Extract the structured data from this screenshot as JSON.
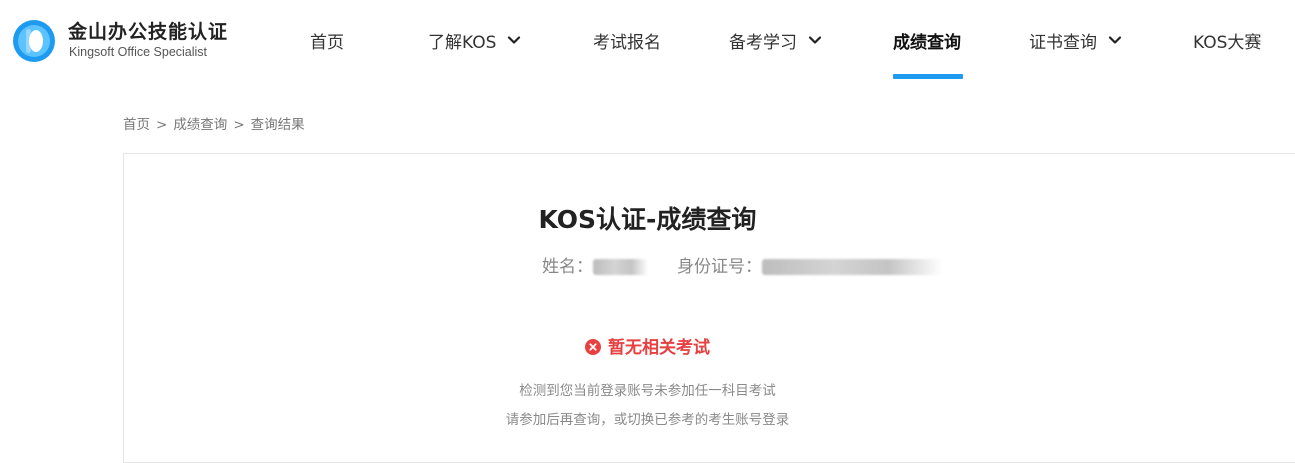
{
  "brand": {
    "title": "金山办公技能认证",
    "subtitle": "Kingsoft Office Specialist"
  },
  "nav": {
    "home": "首页",
    "about": "了解KOS",
    "register": "考试报名",
    "study": "备考学习",
    "scores": "成绩查询",
    "certificate": "证书查询",
    "contest": "KOS大赛"
  },
  "breadcrumb": {
    "home": "首页",
    "scores": "成绩查询",
    "current": "查询结果",
    "separator": ">"
  },
  "result": {
    "title": "KOS认证-成绩查询",
    "name_label": "姓名：",
    "id_label": "身份证号：",
    "status": "暂无相关考试",
    "message_line1": "检测到您当前登录账号未参加任一科目考试",
    "message_line2": "请参加后再查询，或切换已参考的考生账号登录"
  },
  "colors": {
    "accent": "#1e9bf0",
    "error": "#e84040",
    "logo_blue": "#1e9bf0"
  },
  "icons": {
    "logo": "kos-logo-icon",
    "dropdown": "chevron-down-icon",
    "error": "error-circle-icon"
  }
}
